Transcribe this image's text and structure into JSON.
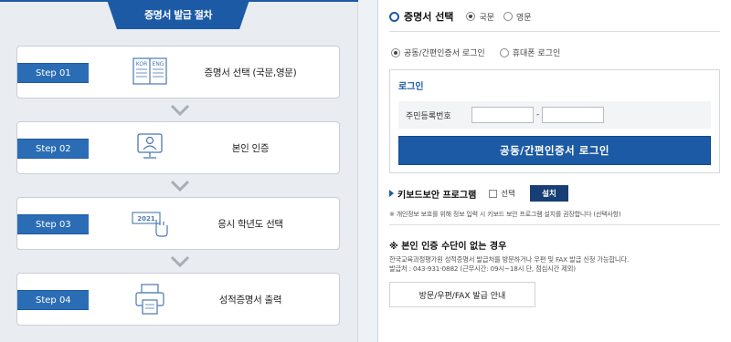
{
  "left_panel": {
    "title": "증명서 발급 절차",
    "steps": [
      {
        "badge": "Step 01",
        "label": "증명서 선택 (국문,영문)",
        "icon": "book-kor-eng-icon",
        "icon_text_1": "KOR",
        "icon_text_2": "ENG"
      },
      {
        "badge": "Step 02",
        "label": "본인 인증",
        "icon": "monitor-user-icon"
      },
      {
        "badge": "Step 03",
        "label": "응시 학년도 선택",
        "icon": "year-click-icon",
        "icon_text_1": "2021"
      },
      {
        "badge": "Step 04",
        "label": "성적증명서 출력",
        "icon": "printer-icon"
      }
    ]
  },
  "right_panel": {
    "cert_select": {
      "title": "증명서 선택",
      "options": [
        "국문",
        "영문"
      ],
      "selected": "국문"
    },
    "login_type": {
      "options": [
        "공동/간편인증서 로그인",
        "휴대폰 로그인"
      ],
      "selected": "공동/간편인증서 로그인"
    },
    "login_box": {
      "title": "로그인",
      "id_label": "주민등록번호",
      "id_part1": "",
      "id_part2": "",
      "dash": "-",
      "login_button": "공동/간편인증서 로그인"
    },
    "keyboard": {
      "title": "키보드보안 프로그램",
      "checkbox_label": "선택",
      "install_button": "설치",
      "note": "※ 개인정보 보호를 위해 정보 입력 시 키보드 보안 프로그램 설치를 권장합니다 (선택사항)"
    },
    "alternative": {
      "title": "※ 본인 인증 수단이 없는 경우",
      "line1": "한국교육과정평가원 성적증명서 발급처를 방문하거나 우편 및 FAX 발급 신청 가능합니다.",
      "line2": "발급처 : 043-931-0882 (근무시간: 09시~18시 단, 점심시간 제외)",
      "button": "방문/우편/FAX 발급 안내"
    }
  },
  "colors": {
    "accent": "#1d5aa6",
    "step_badge": "#2b6db5",
    "install_btn": "#173f73",
    "panel_bg": "#e9ecf1"
  }
}
